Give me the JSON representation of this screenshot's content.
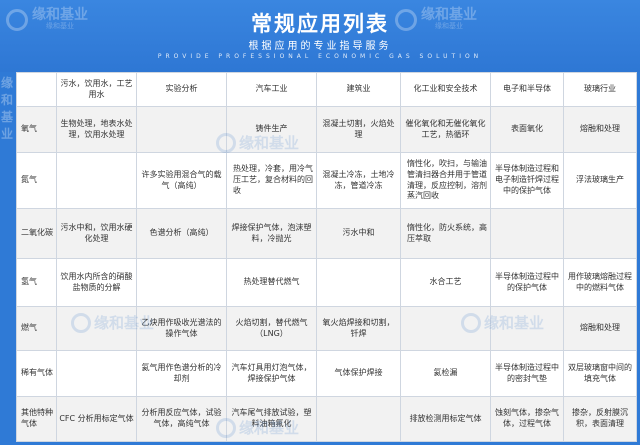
{
  "header": {
    "title": "常规应用列表",
    "subtitle": "根据应用的专业指导服务",
    "en_subtitle": "PROVIDE PROFESSIONAL ECONOMIC GAS SOLUTION"
  },
  "watermark": {
    "brand": "缘和基业",
    "brand_sub": "缘和基业"
  },
  "table": {
    "headers": [
      "",
      "污水，饮用水，工艺用水",
      "实验分析",
      "汽车工业",
      "建筑业",
      "化工业和安全技术",
      "电子和半导体",
      "玻璃行业"
    ],
    "rows": [
      [
        "氧气",
        "生物处理，地表水处理，饮用水处理",
        "",
        "铸件生产",
        "混凝土切割，火焰处理",
        "催化氧化和无催化氧化工艺，热循环",
        "表面氧化",
        "熔融和处理"
      ],
      [
        "氮气",
        "",
        "许多实验用混合气的载气（高纯）",
        "热处理，冷套，用冷气压工艺，复合材料的回收",
        "混凝土冷冻，土地冷冻，管道冷冻",
        "惰性化，吹扫，与输油管清扫器合并用于管道清理，反应控制，溶剂蒸汽回收",
        "半导体制造过程和电子制造钎焊过程中的保护气体",
        "浮法玻璃生产"
      ],
      [
        "二氧化碳",
        "污水中和，饮用水硬化处理",
        "色谱分析（高纯）",
        "焊接保护气体，泡沫塑料，冷抛光",
        "污水中和",
        "惰性化，防火系统，高压萃取",
        "",
        ""
      ],
      [
        "氢气",
        "饮用水内所含的硝酸盐物质的分解",
        "",
        "热处理替代燃气",
        "",
        "水合工艺",
        "半导体制造过程中的保护气体",
        "用作玻璃熔融过程中的燃料气体"
      ],
      [
        "燃气",
        "",
        "乙炔用作吸收光谱法的操作气体",
        "火焰切割，替代燃气（LNG）",
        "氧火焰焊接和切割，钎焊",
        "",
        "",
        "熔融和处理"
      ],
      [
        "稀有气体",
        "",
        "氦气用作色谱分析的冷却剂",
        "汽车灯具用灯泡气体，焊接保护气体",
        "气体保护焊接",
        "氦检漏",
        "半导体制造过程中的密封气垫",
        "双层玻璃窗中间的填充气体"
      ],
      [
        "其他特种气体",
        "CFC 分析用标定气体",
        "分析用反应气体，试验气体，高纯气体",
        "汽车尾气排放试验，塑料油箱氟化",
        "",
        "排放检测用标定气体",
        "蚀刻气体，掺杂气体，过程气体",
        "掺杂，反射膜沉积，表面清理"
      ]
    ]
  },
  "colors": {
    "header_bg": "#2f7ad6",
    "row_alt_bg": "#f2f2f2",
    "border": "#cfd6e0"
  }
}
